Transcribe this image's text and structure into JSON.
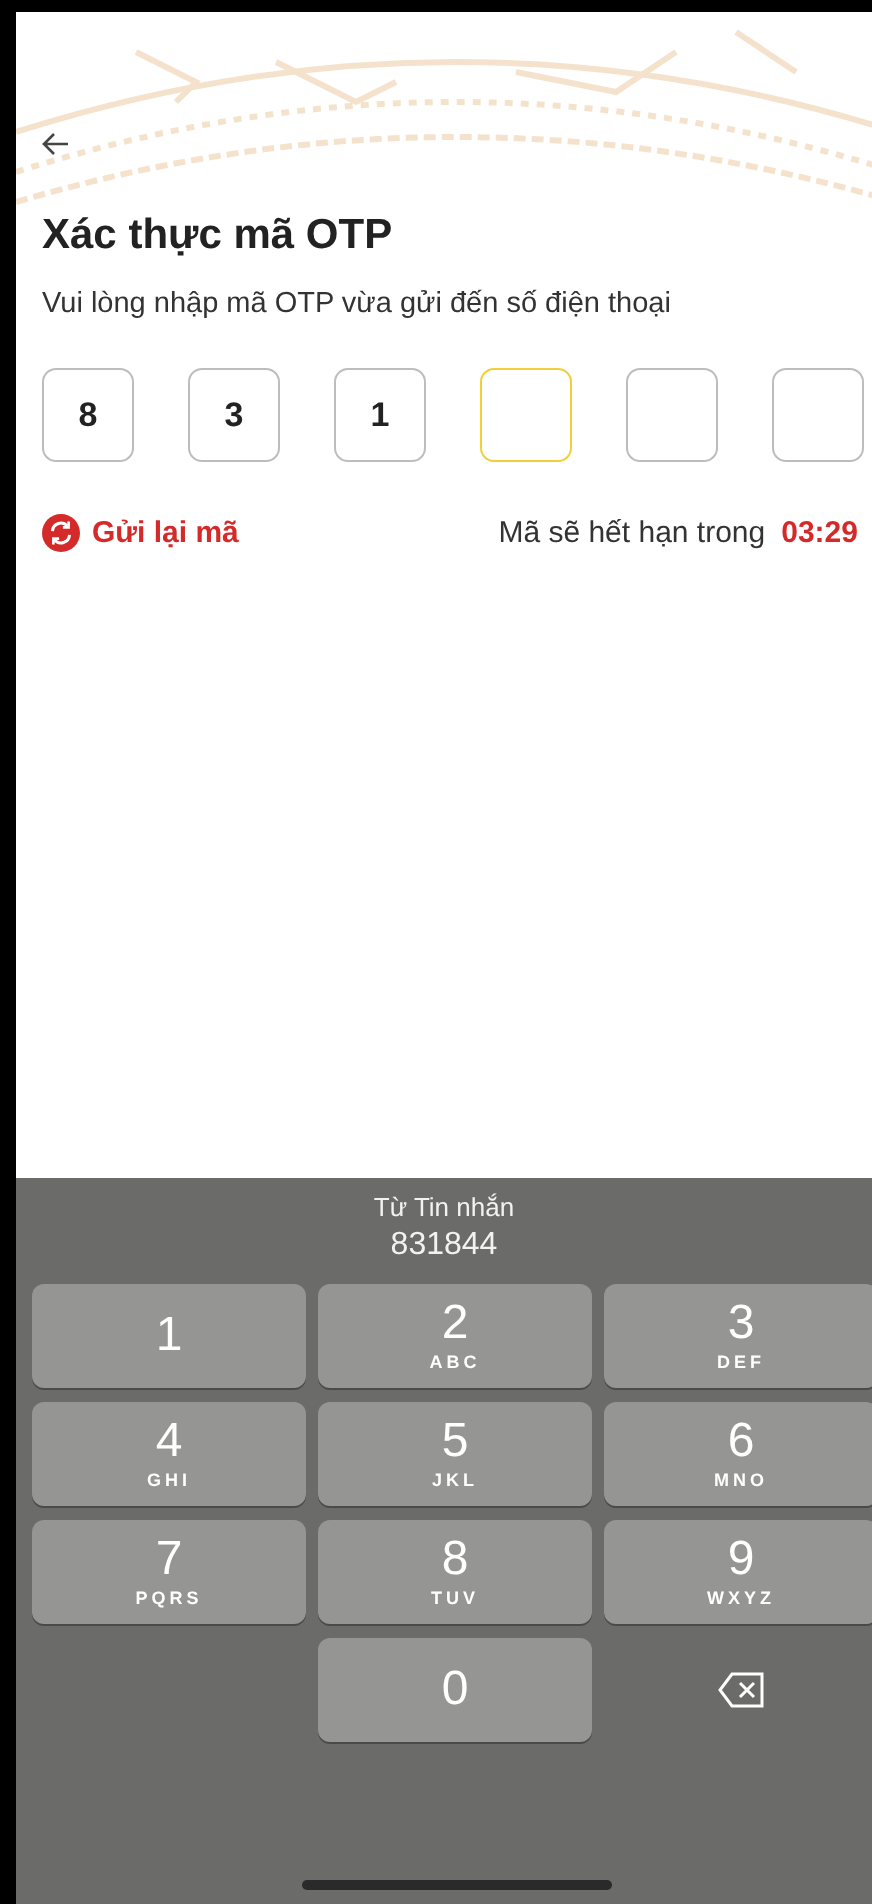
{
  "header": {
    "title": "Xác thực mã OTP",
    "subtitle": "Vui lòng nhập mã OTP vừa gửi đến số điện thoại"
  },
  "otp_boxes": [
    {
      "value": "8",
      "focused": false
    },
    {
      "value": "3",
      "focused": false
    },
    {
      "value": "1",
      "focused": false
    },
    {
      "focused": true
    },
    {
      "focused": false
    },
    {
      "focused": false
    }
  ],
  "resend": {
    "label": "Gửi lại mã"
  },
  "expiry": {
    "label": "Mã sẽ hết hạn trong",
    "time": "03:29"
  },
  "keyboard": {
    "suggestion": {
      "source": "Từ Tin nhắn",
      "code": "831844"
    },
    "keys": [
      {
        "kind": "digit",
        "digit": "1"
      },
      {
        "kind": "digit",
        "digit": "2",
        "letters": "ABC"
      },
      {
        "kind": "digit",
        "digit": "3",
        "letters": "DEF"
      },
      {
        "kind": "digit",
        "digit": "4",
        "letters": "GHI"
      },
      {
        "kind": "digit",
        "digit": "5",
        "letters": "JKL"
      },
      {
        "kind": "digit",
        "digit": "6",
        "letters": "MNO"
      },
      {
        "kind": "digit",
        "digit": "7",
        "letters": "PQRS"
      },
      {
        "kind": "digit",
        "digit": "8",
        "letters": "TUV"
      },
      {
        "kind": "digit",
        "digit": "9",
        "letters": "WXYZ"
      },
      {
        "kind": "blank"
      },
      {
        "kind": "digit",
        "digit": "0"
      },
      {
        "kind": "delete"
      }
    ]
  }
}
